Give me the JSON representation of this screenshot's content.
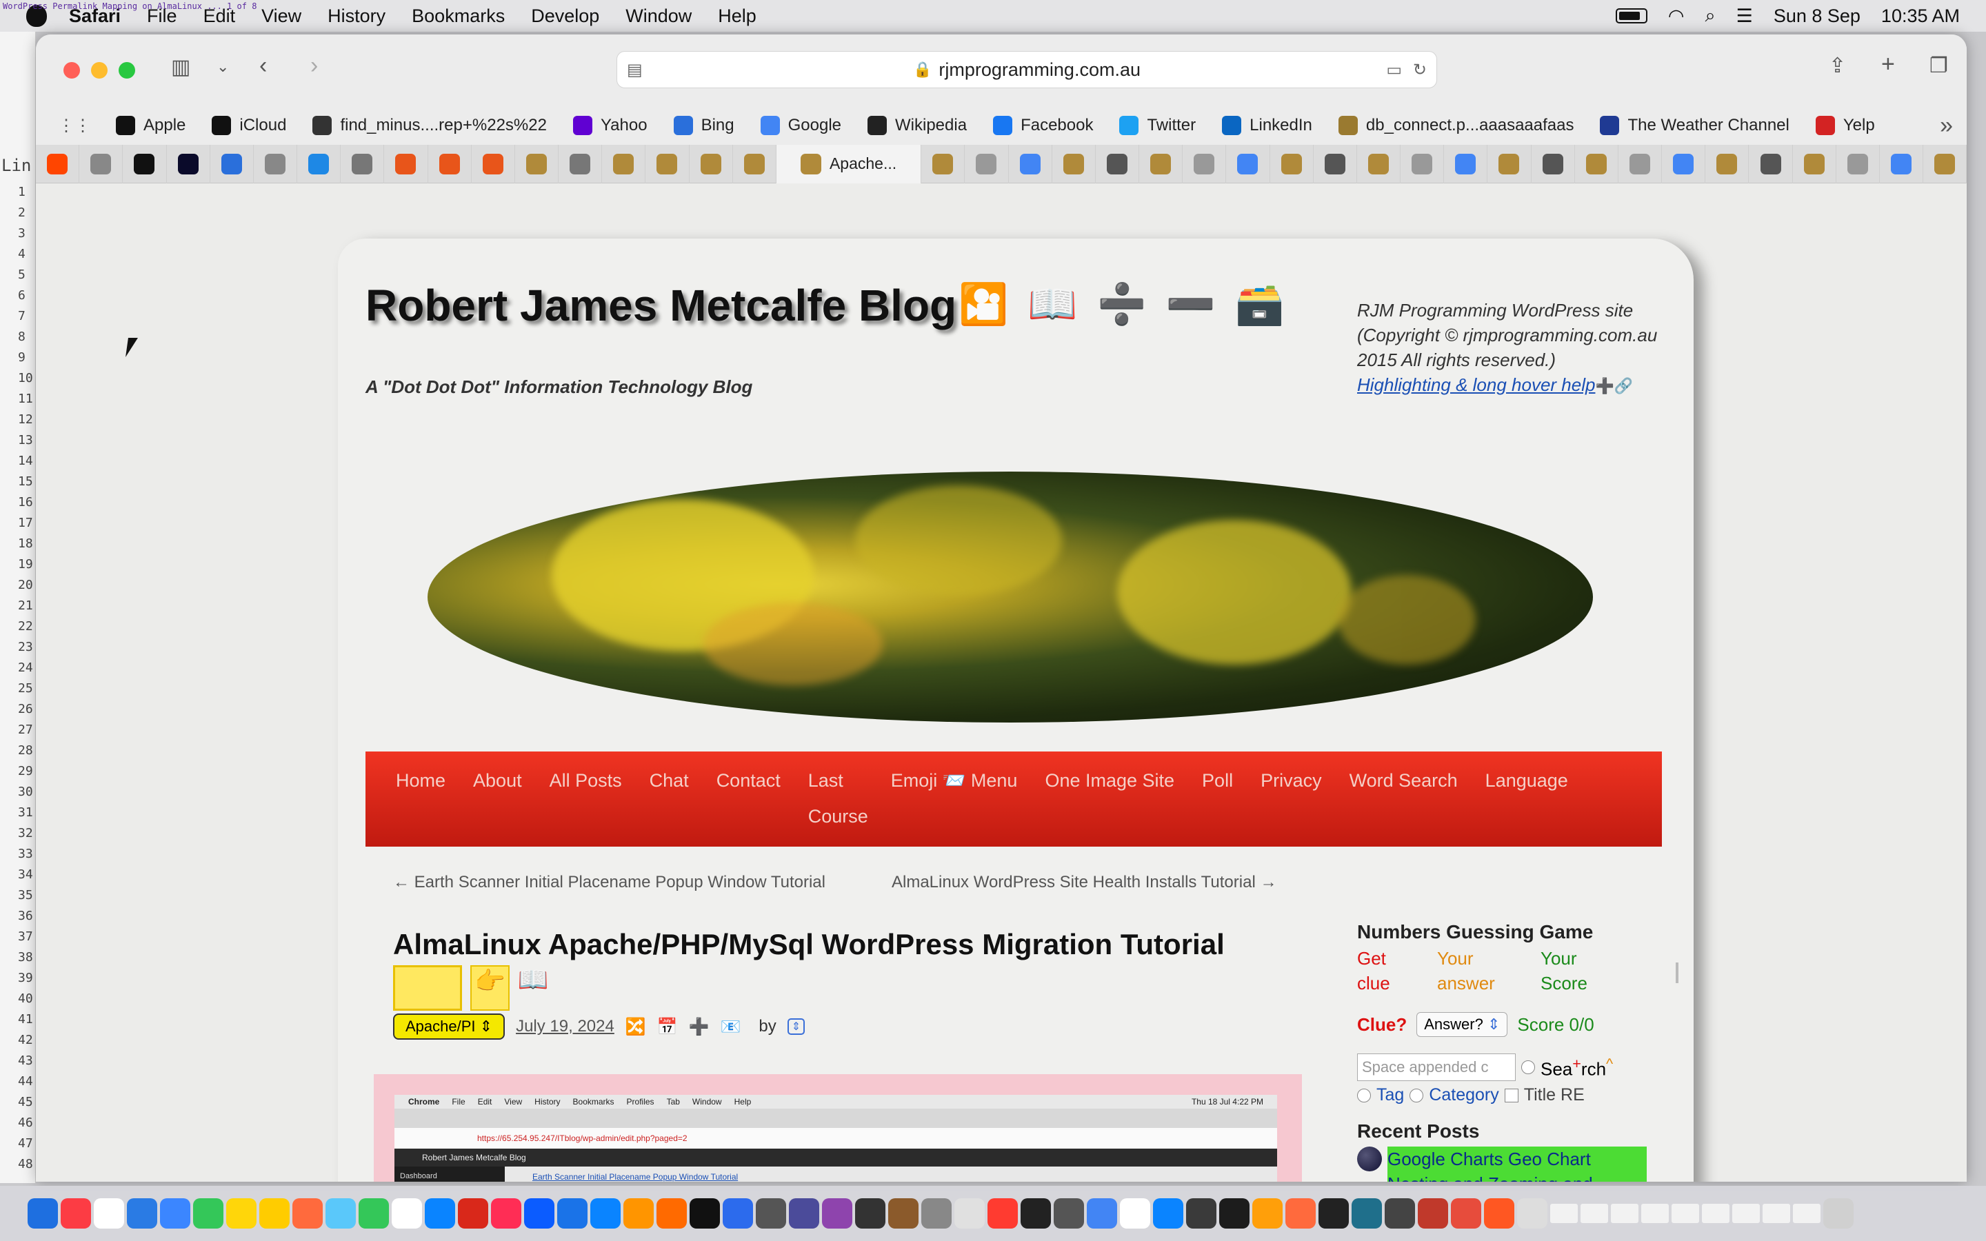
{
  "menubar": {
    "app": "Safari",
    "items": [
      "File",
      "Edit",
      "View",
      "History",
      "Bookmarks",
      "Develop",
      "Window",
      "Help"
    ],
    "date": "Sun 8 Sep",
    "time": "10:35 AM",
    "tiny_title": "WordPress Permalink Mapping on AlmaLinux ... 1 of 8"
  },
  "toolbar": {
    "url": "rjmprogramming.com.au"
  },
  "bookmarks": [
    {
      "label": "Apple",
      "icon": "apple-icon",
      "color": "#111111"
    },
    {
      "label": "iCloud",
      "icon": "apple-icon",
      "color": "#111111"
    },
    {
      "label": "find_minus....rep+%22s%22",
      "icon": "github-icon",
      "color": "#333333"
    },
    {
      "label": "Yahoo",
      "icon": "yahoo-icon",
      "color": "#6001d2"
    },
    {
      "label": "Bing",
      "icon": "search-icon",
      "color": "#2a6fdb"
    },
    {
      "label": "Google",
      "icon": "google-icon",
      "color": "#4285f4"
    },
    {
      "label": "Wikipedia",
      "icon": "wikipedia-icon",
      "color": "#222222"
    },
    {
      "label": "Facebook",
      "icon": "facebook-icon",
      "color": "#1877f2"
    },
    {
      "label": "Twitter",
      "icon": "twitter-icon",
      "color": "#1da1f2"
    },
    {
      "label": "LinkedIn",
      "icon": "linkedin-icon",
      "color": "#0a66c2"
    },
    {
      "label": "db_connect.p...aaasaaafaas",
      "icon": "feather-icon",
      "color": "#9a7a30"
    },
    {
      "label": "The Weather Channel",
      "icon": "weather-icon",
      "color": "#1f3a93"
    },
    {
      "label": "Yelp",
      "icon": "yelp-icon",
      "color": "#d32323"
    }
  ],
  "tabs": {
    "active_label": "Apache..."
  },
  "blog": {
    "title": "Robert James Metcalfe Blog",
    "title_icons": [
      "🎦",
      "📖",
      "➗",
      "➖",
      "🗃️"
    ],
    "tagline": "A \"Dot Dot Dot\" Information Technology Blog",
    "site_info": "RJM Programming WordPress site (Copyright © rjmprogramming.com.au 2015 All rights reserved.)",
    "help_link": "Highlighting & long hover help",
    "help_suffix": "➕🔗"
  },
  "nav": [
    "Home",
    "About",
    "All Posts",
    "Chat",
    "Contact",
    "Last Course",
    "Emoji 📨 Menu",
    "One Image Site",
    "Poll",
    "Privacy",
    "Word Search",
    "Language"
  ],
  "post": {
    "prev": "← Earth Scanner Initial Placename Popup Window Tutorial",
    "next": "AlmaLinux WordPress Site Health Installs Tutorial →",
    "title": "AlmaLinux Apache/PHP/MySql WordPress Migration Tutorial",
    "category": "Apache/PI",
    "date": "July 19, 2024",
    "by": "by"
  },
  "screenshot": {
    "menu": [
      "Chrome",
      "File",
      "Edit",
      "View",
      "History",
      "Bookmarks",
      "Profiles",
      "Tab",
      "Window",
      "Help"
    ],
    "date": "Thu 18 Jul 4:22 PM",
    "addr": "https://65.254.95.247/ITblog/wp-admin/edit.php?paged=2",
    "site": "Robert James Metcalfe Blog",
    "dashboard": "Dashboard",
    "row": "Earth Scanner Initial Placename Popup Window Tutorial"
  },
  "sidebar": {
    "game_title": "Numbers Guessing Game",
    "col1": "Get clue",
    "col2": "Your answer",
    "col3": "Your Score",
    "clue": "Clue?",
    "answer": "Answer?",
    "score": "Score 0/0",
    "search_placeholder": "Space appended c",
    "search_label": "Sea",
    "search_mid": "+",
    "search_end": "rch",
    "tag": "Tag",
    "category": "Category",
    "title_re": "Title RE",
    "recent_title": "Recent Posts",
    "recent_post": "Google Charts Geo Chart Nesting and Zooming and"
  }
}
